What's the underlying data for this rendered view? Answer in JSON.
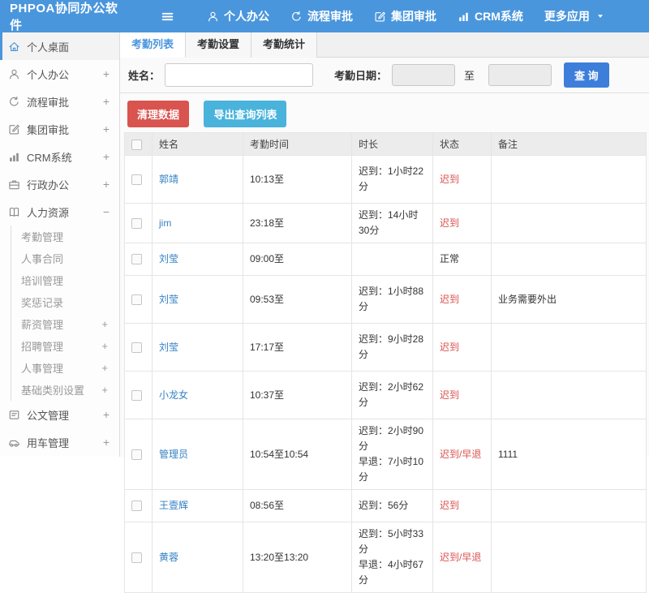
{
  "colors": {
    "header_blue": "#4a96dd",
    "search_button_blue": "#3e7edb",
    "danger_red": "#d9534f",
    "info_teal": "#49b3dc",
    "link_blue": "#3481c4",
    "status_red": "#d9534f"
  },
  "header": {
    "logo": "PHPOA协同办公软件",
    "nav": [
      {
        "id": "nav-personal-office",
        "label": "个人办公",
        "icon": "person-icon"
      },
      {
        "id": "nav-workflow-approval",
        "label": "流程审批",
        "icon": "flow-icon"
      },
      {
        "id": "nav-group-approval",
        "label": "集团审批",
        "icon": "edit-icon"
      },
      {
        "id": "nav-crm-system",
        "label": "CRM系统",
        "icon": "bar-chart-icon"
      },
      {
        "id": "nav-more-apps",
        "label": "更多应用",
        "icon": "caret-down-icon",
        "icon_position": "right"
      }
    ]
  },
  "sidebar": {
    "items": [
      {
        "id": "sidebar-item-personal-desktop",
        "label": "个人桌面",
        "icon": "home-icon",
        "active": true,
        "expand": ""
      },
      {
        "id": "sidebar-item-personal-office",
        "label": "个人办公",
        "icon": "person-icon",
        "expand": "+"
      },
      {
        "id": "sidebar-item-workflow-approval",
        "label": "流程审批",
        "icon": "flow-icon",
        "expand": "+"
      },
      {
        "id": "sidebar-item-group-approval",
        "label": "集团审批",
        "icon": "edit-icon",
        "expand": "+"
      },
      {
        "id": "sidebar-item-crm-system",
        "label": "CRM系统",
        "icon": "bar-chart-icon",
        "expand": "+"
      },
      {
        "id": "sidebar-item-admin-office",
        "label": "行政办公",
        "icon": "briefcase-icon",
        "expand": "+"
      },
      {
        "id": "sidebar-item-hr",
        "label": "人力资源",
        "icon": "book-icon",
        "expand": "−",
        "subitems": [
          {
            "id": "sidebar-subitem-attendance",
            "label": "考勤管理",
            "expand": ""
          },
          {
            "id": "sidebar-subitem-hr-contract",
            "label": "人事合同",
            "expand": ""
          },
          {
            "id": "sidebar-subitem-training",
            "label": "培训管理",
            "expand": ""
          },
          {
            "id": "sidebar-subitem-reward-punish",
            "label": "奖惩记录",
            "expand": ""
          },
          {
            "id": "sidebar-subitem-salary",
            "label": "薪资管理",
            "expand": "+"
          },
          {
            "id": "sidebar-subitem-recruitment",
            "label": "招聘管理",
            "expand": "+"
          },
          {
            "id": "sidebar-subitem-personnel",
            "label": "人事管理",
            "expand": "+"
          },
          {
            "id": "sidebar-subitem-base-category",
            "label": "基础类别设置",
            "expand": "+"
          }
        ]
      },
      {
        "id": "sidebar-item-document-mgmt",
        "label": "公文管理",
        "icon": "document-icon",
        "expand": "+"
      },
      {
        "id": "sidebar-item-vehicle-mgmt",
        "label": "用车管理",
        "icon": "car-icon",
        "expand": "+"
      }
    ]
  },
  "tabs": {
    "active_index": 0,
    "items": [
      {
        "id": "tab-attendance-list",
        "label": "考勤列表"
      },
      {
        "id": "tab-attendance-settings",
        "label": "考勤设置"
      },
      {
        "id": "tab-attendance-statistics",
        "label": "考勤统计"
      }
    ]
  },
  "filter": {
    "name_label": "姓名：",
    "name_value": "",
    "date_label": "考勤日期：",
    "date_from_value": "",
    "to_label": "至",
    "date_to_value": "",
    "search_label": "查 询"
  },
  "actions": {
    "clear_label": "清理数据",
    "export_label": "导出查询列表"
  },
  "table": {
    "columns": [
      "姓名",
      "考勤时间",
      "时长",
      "状态",
      "备注"
    ],
    "rows": [
      {
        "name": "郭靖",
        "time": "10:13至",
        "duration": [
          "迟到：1小时22分"
        ],
        "status": "迟到",
        "alert": true,
        "remark": ""
      },
      {
        "name": "jim",
        "time": "23:18至",
        "duration": [
          "迟到：14小时30分"
        ],
        "status": "迟到",
        "alert": true,
        "remark": "",
        "tall": true
      },
      {
        "name": "刘莹",
        "time": "09:00至",
        "duration": [],
        "status": "正常",
        "alert": false,
        "remark": ""
      },
      {
        "name": "刘莹",
        "time": "09:53至",
        "duration": [
          "迟到：1小时88分"
        ],
        "status": "迟到",
        "alert": true,
        "remark": "业务需要外出"
      },
      {
        "name": "刘莹",
        "time": "17:17至",
        "duration": [
          "迟到：9小时28分"
        ],
        "status": "迟到",
        "alert": true,
        "remark": ""
      },
      {
        "name": "小龙女",
        "time": "10:37至",
        "duration": [
          "迟到：2小时62分"
        ],
        "status": "迟到",
        "alert": true,
        "remark": ""
      },
      {
        "name": "管理员",
        "time": "10:54至10:54",
        "duration": [
          "迟到：2小时90分",
          "早退：7小时10分"
        ],
        "status": "迟到/早退",
        "alert": true,
        "remark": "1111",
        "tall": true
      },
      {
        "name": "王壹辉",
        "time": "08:56至",
        "duration": [
          "迟到：56分"
        ],
        "status": "迟到",
        "alert": true,
        "remark": ""
      },
      {
        "name": "黄蓉",
        "time": "13:20至13:20",
        "duration": [
          "迟到：5小时33分",
          "早退：4小时67分"
        ],
        "status": "迟到/早退",
        "alert": true,
        "remark": "",
        "tall": true
      }
    ]
  }
}
